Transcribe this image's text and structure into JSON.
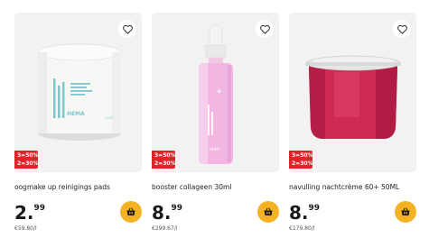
{
  "products": [
    {
      "title": "oogmake up reinigings pads",
      "price_euros": "2.",
      "price_cents": "99",
      "unit_price": "€59.80/l",
      "promo_line1": "3=50%",
      "promo_line2": "2=30%",
      "jar_brand": "HEMA",
      "jar_text": "make-up remover pads",
      "image_icon": "pads-jar-image"
    },
    {
      "title": "booster collageen 30ml",
      "price_euros": "8.",
      "price_cents": "99",
      "unit_price": "€299.67/l",
      "promo_line1": "3=50%",
      "promo_line2": "2=30%",
      "jar_brand": "HEMA",
      "image_icon": "serum-dropper-bottle-image"
    },
    {
      "title": "navulling nachtcrème 60+ 50ML",
      "price_euros": "8.",
      "price_cents": "99",
      "unit_price": "€179.80/l",
      "promo_line1": "3=50%",
      "promo_line2": "2=30%",
      "image_icon": "cream-refill-jar-image"
    }
  ],
  "colors": {
    "promo": "#e3232a",
    "cart_button": "#f4b324",
    "image_background": "#f2f2f2"
  },
  "icons": {
    "favorite": "heart-icon",
    "cart": "basket-icon"
  }
}
